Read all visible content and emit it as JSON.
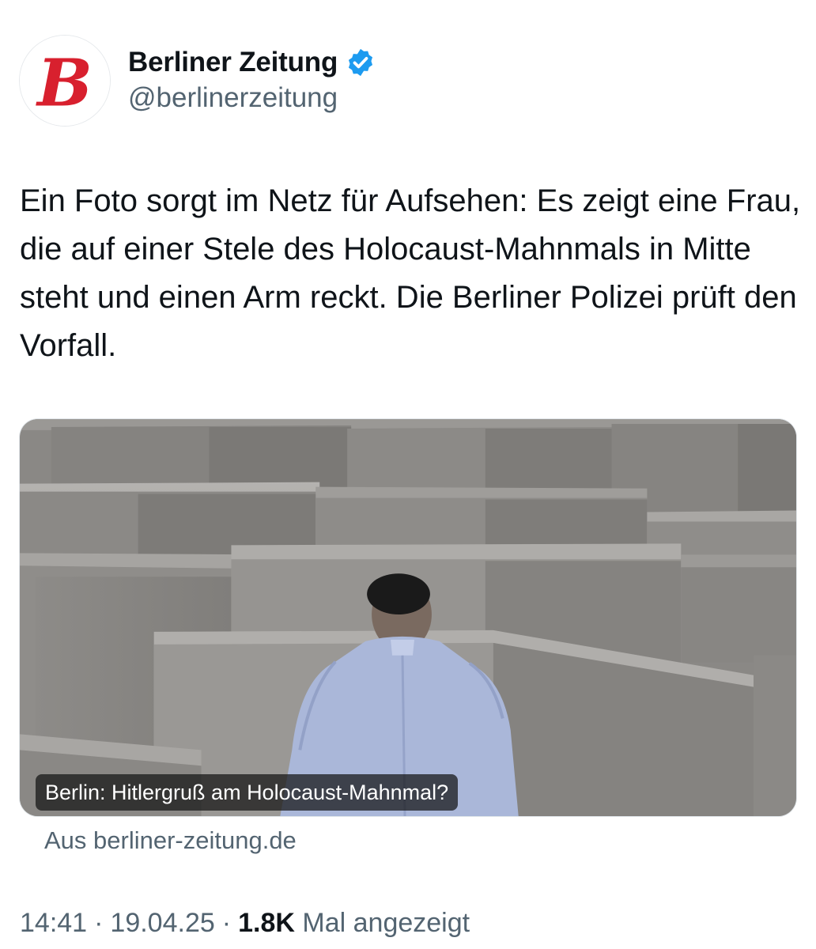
{
  "profile": {
    "logo_letter": "B",
    "display_name": "Berliner Zeitung",
    "handle": "@berlinerzeitung",
    "verified_icon": "verified-badge-icon",
    "logo_color": "#d8202e",
    "verified_color": "#1d9bf0"
  },
  "tweet": {
    "text": "Ein Foto sorgt im Netz für Aufsehen: Es zeigt eine Frau, die auf einer Stele des Holocaust-Mahnmals in Mitte steht und einen Arm reckt. Die Berliner Polizei prüft den Vorfall."
  },
  "card": {
    "caption": "Berlin: Hitlergruß am Holocaust-Mahnmal?",
    "source": "Aus berliner-zeitung.de"
  },
  "meta": {
    "time": "14:41",
    "date": "19.04.25",
    "separator": "·",
    "views_count": "1.8K",
    "views_label": "Mal angezeigt"
  }
}
